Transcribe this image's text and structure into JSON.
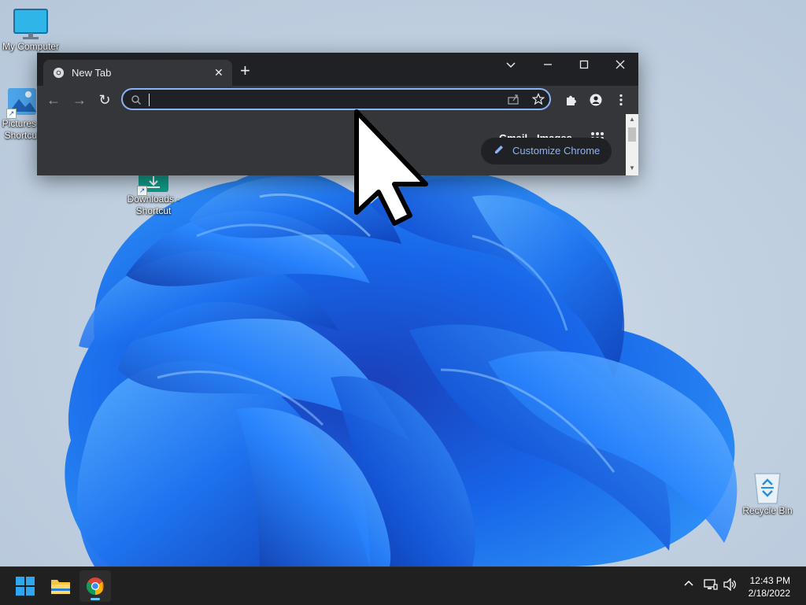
{
  "desktop": {
    "icons": [
      {
        "label": "My Computer",
        "icon": "monitor-icon"
      },
      {
        "label": "Pictures - Shortcut",
        "icon": "pictures-folder-icon"
      },
      {
        "label": "Downloads - Shortcut",
        "icon": "downloads-icon"
      },
      {
        "label": "Recycle Bin",
        "icon": "recycle-bin-icon"
      }
    ]
  },
  "browser": {
    "tab_title": "New Tab",
    "tab_close": "✕",
    "new_tab": "+",
    "window_controls": {
      "dropdown": "⌄",
      "minimize": "—",
      "maximize": "☐",
      "close": "✕"
    },
    "toolbar": {
      "back": "←",
      "forward": "→",
      "reload": "↻",
      "search_placeholder": "",
      "search_value": ""
    },
    "newtab_page": {
      "gmail_label": "Gmail",
      "images_label": "Images",
      "customize_label": "Customize Chrome"
    }
  },
  "taskbar": {
    "apps": [
      "start-button",
      "file-explorer",
      "chrome"
    ],
    "clock_time": "12:43 PM",
    "clock_date": "2/18/2022"
  },
  "colors": {
    "accent": "#8ab4f8",
    "chrome_dark": "#202124",
    "chrome_toolbar": "#35363a",
    "taskbar": "#202020",
    "wallpaper_blue": "#1e63e0"
  }
}
